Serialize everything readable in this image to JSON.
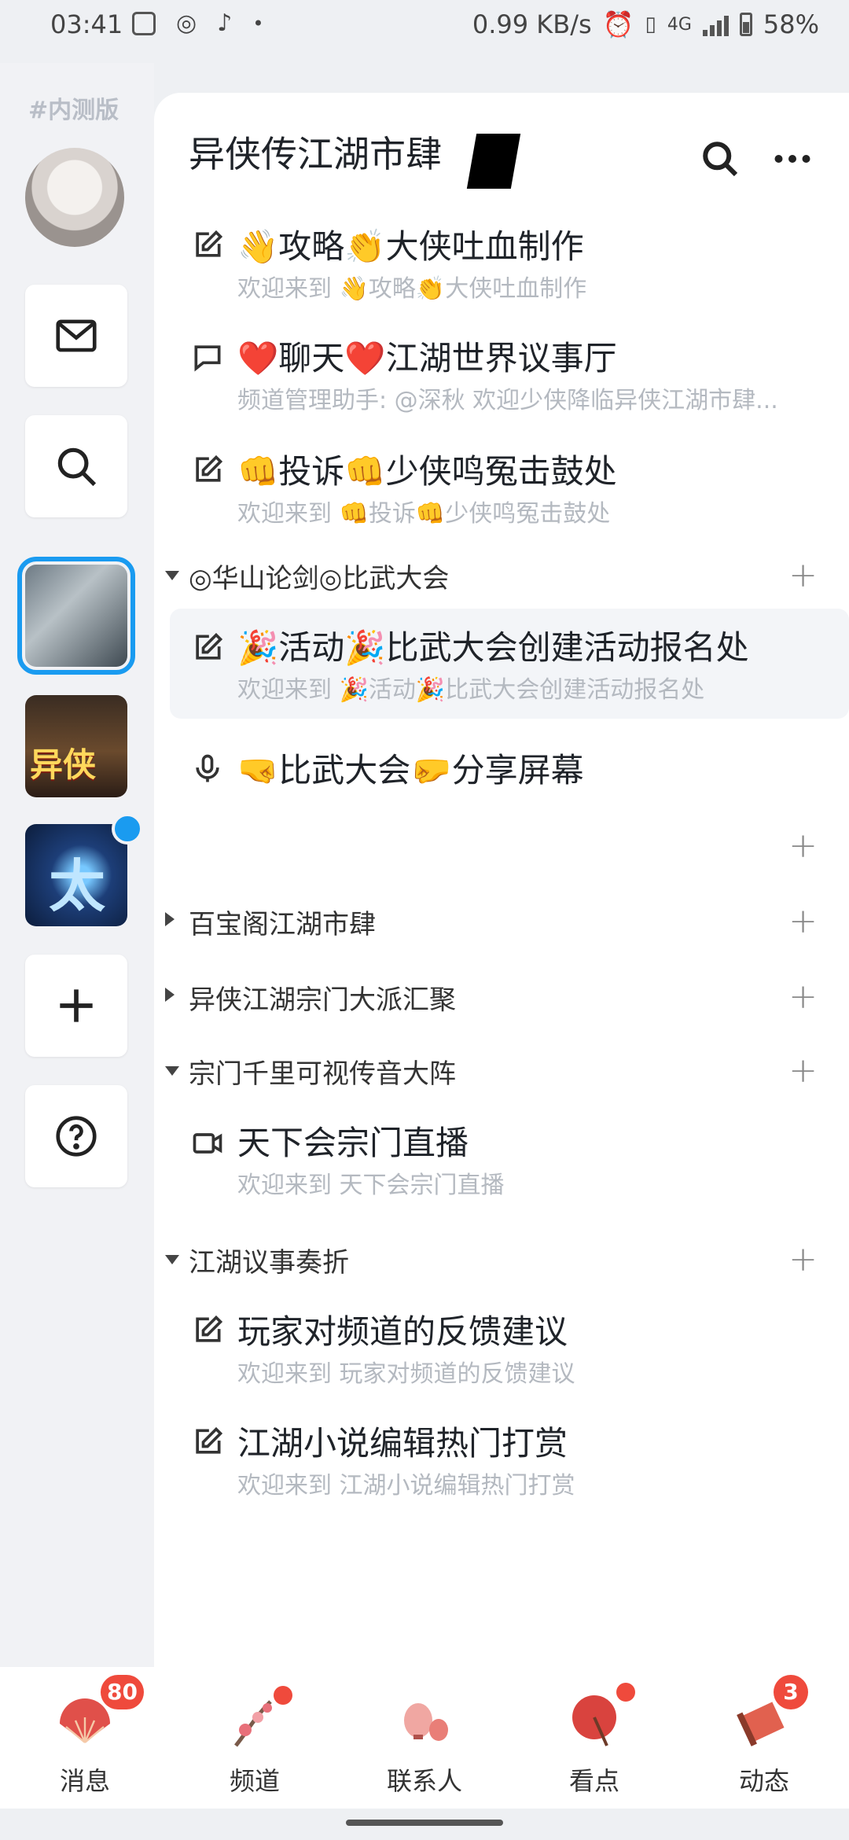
{
  "status_bar": {
    "time": "03:41",
    "net_speed": "0.99 KB/s",
    "network": "4G",
    "battery": "58%"
  },
  "rail": {
    "beta_label": "#内测版",
    "guild2_text": "异侠",
    "guild3_text": "太"
  },
  "header": {
    "title": "异侠传江湖市肆",
    "search_icon": "search-icon",
    "more_icon": "more-icon"
  },
  "channels_top": [
    {
      "icon": "edit-icon",
      "name": "👋攻略👏大侠吐血制作",
      "sub": "欢迎来到 👋攻略👏大侠吐血制作"
    },
    {
      "icon": "chat-icon",
      "name": "❤️聊天❤️江湖世界议事厅",
      "sub": "频道管理助手: @深秋 欢迎少侠降临异侠江湖市肆..."
    },
    {
      "icon": "edit-icon",
      "name": "👊投诉👊少侠鸣冤击鼓处",
      "sub": "欢迎来到 👊投诉👊少侠鸣冤击鼓处"
    }
  ],
  "categories": [
    {
      "title": "◎华山论剑◎比武大会",
      "expanded": true,
      "channels": [
        {
          "icon": "edit-icon",
          "name": "🎉活动🎉比武大会创建活动报名处",
          "sub": "欢迎来到 🎉活动🎉比武大会创建活动报名处",
          "active": true
        },
        {
          "icon": "mic-icon",
          "name": "🤜比武大会🤛分享屏幕",
          "sub": ""
        }
      ]
    },
    {
      "title": "",
      "expanded": false,
      "channels": []
    },
    {
      "title": "百宝阁江湖市肆",
      "expanded": false,
      "channels": []
    },
    {
      "title": "异侠江湖宗门大派汇聚",
      "expanded": false,
      "channels": []
    },
    {
      "title": "宗门千里可视传音大阵",
      "expanded": true,
      "channels": [
        {
          "icon": "video-icon",
          "name": "天下会宗门直播",
          "sub": "欢迎来到 天下会宗门直播"
        }
      ]
    },
    {
      "title": "江湖议事奏折",
      "expanded": true,
      "channels": [
        {
          "icon": "edit-icon",
          "name": "玩家对频道的反馈建议",
          "sub": "欢迎来到 玩家对频道的反馈建议"
        },
        {
          "icon": "edit-icon",
          "name": "江湖小说编辑热门打赏",
          "sub": "欢迎来到 江湖小说编辑热门打赏"
        }
      ]
    }
  ],
  "tabs": [
    {
      "label": "消息",
      "badge": "80",
      "icon": "fan-icon"
    },
    {
      "label": "频道",
      "badge": "",
      "icon": "plum-branch-icon"
    },
    {
      "label": "联系人",
      "badge": "",
      "icon": "lanterns-icon"
    },
    {
      "label": "看点",
      "badge": "",
      "icon": "umbrella-icon"
    },
    {
      "label": "动态",
      "badge": "3",
      "icon": "scroll-icon"
    }
  ],
  "colors": {
    "accent": "#1a9bf0",
    "badge": "#ef4a3c"
  }
}
